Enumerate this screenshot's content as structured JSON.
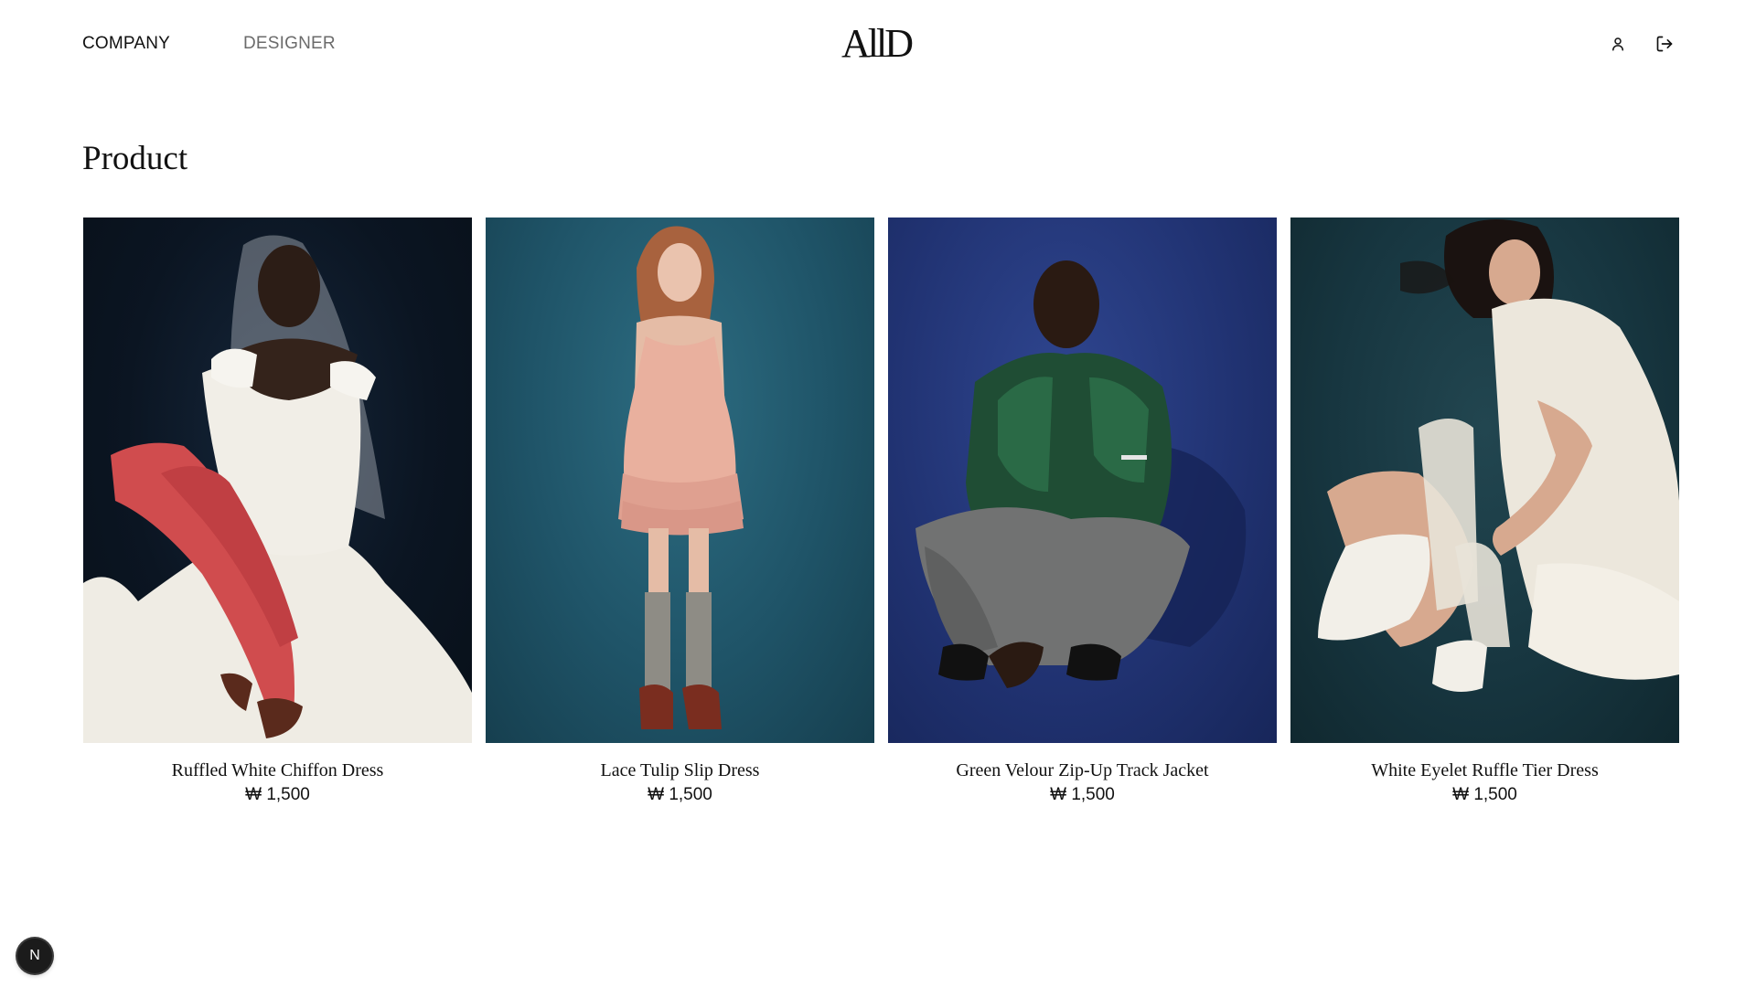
{
  "header": {
    "nav": [
      {
        "label": "COMPANY",
        "active": true
      },
      {
        "label": "DESIGNER",
        "active": false
      }
    ],
    "logo": "AllD",
    "icons": [
      "user-icon",
      "logout-icon"
    ]
  },
  "page": {
    "title": "Product"
  },
  "products": [
    {
      "name": "Ruffled White Chiffon Dress",
      "price": "₩ 1,500"
    },
    {
      "name": "Lace Tulip Slip Dress",
      "price": "₩ 1,500"
    },
    {
      "name": "Green Velour Zip-Up Track Jacket",
      "price": "₩ 1,500"
    },
    {
      "name": "White Eyelet Ruffle Tier Dress",
      "price": "₩ 1,500"
    }
  ],
  "dev_badge": {
    "label": "N"
  },
  "colors": {
    "text": "#111111",
    "muted_nav": "#6b6b6b",
    "background": "#ffffff"
  }
}
